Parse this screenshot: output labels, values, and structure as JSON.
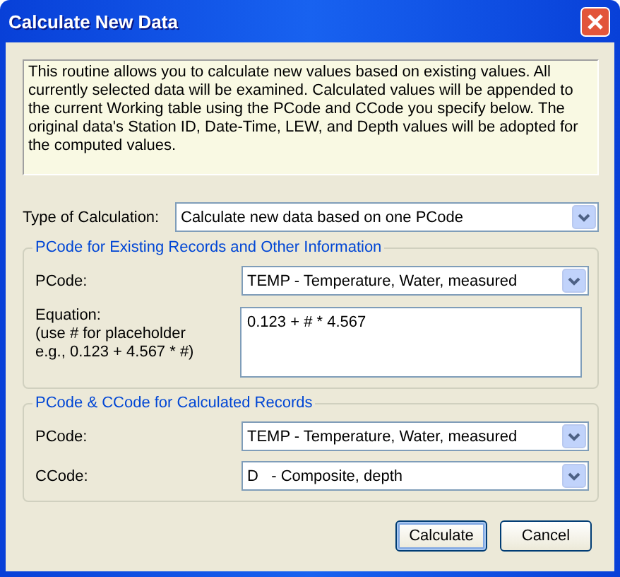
{
  "window": {
    "title": "Calculate New Data"
  },
  "description": "This routine allows you to calculate new values based on existing values. All currently selected data will be examined. Calculated values will be appended to the current Working table using the PCode and CCode you specify below. The original data's Station ID, Date-Time, LEW, and Depth values will be adopted for the computed values.",
  "calculation_type": {
    "label": "Type of Calculation:",
    "value": "Calculate new data based on one PCode"
  },
  "existing_group": {
    "title": "PCode for Existing Records and Other Information",
    "pcode": {
      "label": "PCode:",
      "value": "TEMP - Temperature, Water, measured"
    },
    "equation": {
      "label": "Equation:",
      "hint_lines": [
        "(use # for placeholder",
        "e.g., 0.123 + 4.567 * #)"
      ],
      "value": "0.123 + # * 4.567"
    }
  },
  "calculated_group": {
    "title": "PCode & CCode for Calculated Records",
    "fields": [
      {
        "label": "PCode:",
        "value": "TEMP - Temperature, Water, measured"
      },
      {
        "label": "CCode:",
        "value": "D   - Composite, depth"
      }
    ]
  },
  "buttons": [
    {
      "label": "Calculate",
      "default": true
    },
    {
      "label": "Cancel",
      "default": false
    }
  ]
}
